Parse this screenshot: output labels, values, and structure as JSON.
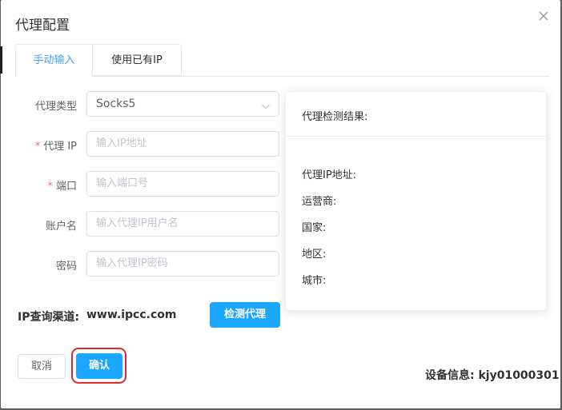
{
  "dialog": {
    "title": "代理配置",
    "close_icon": "close-icon"
  },
  "tabs": [
    {
      "label": "手动输入",
      "active": true
    },
    {
      "label": "使用已有IP",
      "active": false
    }
  ],
  "form": {
    "type_label": "代理类型",
    "type_value": "Socks5",
    "ip_required_mark": "*",
    "ip_label": "代理 IP",
    "ip_placeholder": "输入IP地址",
    "port_required_mark": "*",
    "port_label": "端口",
    "port_placeholder": "输入端口号",
    "user_label": "账户名",
    "user_placeholder": "输入代理IP用户名",
    "pwd_label": "密码",
    "pwd_placeholder": "输入代理IP密码"
  },
  "result": {
    "title": "代理检测结果:",
    "items": [
      "代理IP地址:",
      "运营商:",
      "国家:",
      "地区:",
      "城市:"
    ]
  },
  "channel": {
    "label": "IP查询渠道:",
    "value": "www.ipcc.com"
  },
  "buttons": {
    "check": "检测代理",
    "cancel": "取消",
    "confirm": "确认"
  },
  "device_info": "设备信息: kjy01000301",
  "colors": {
    "primary": "#1aa7ff",
    "active_tab": "#409eff",
    "required": "#f56c6c",
    "highlight": "#e0272d"
  }
}
